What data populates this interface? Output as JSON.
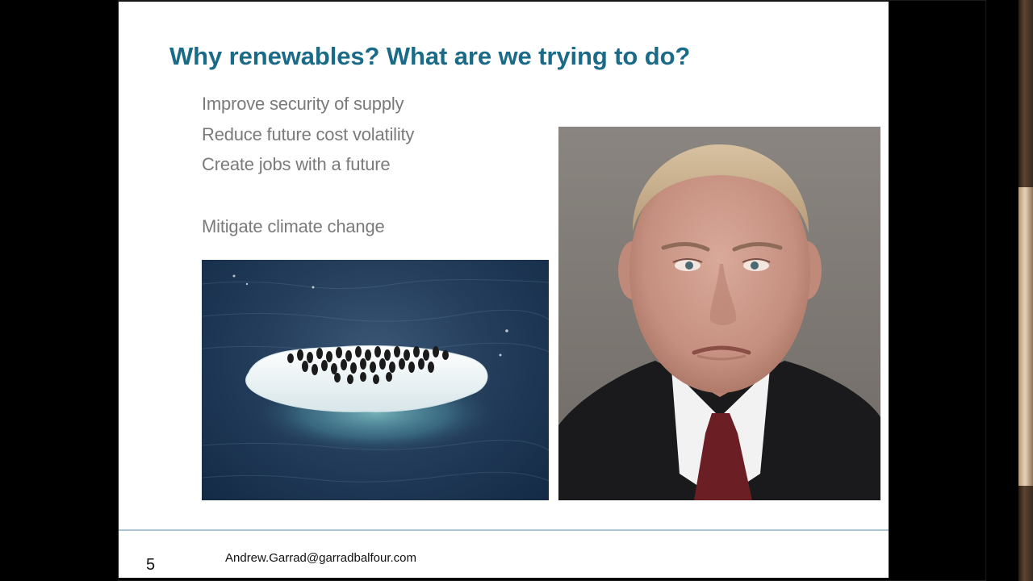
{
  "slide": {
    "title": "Why renewables? What are we trying to do?",
    "bullets": [
      "Improve security of supply",
      "Reduce future cost volatility",
      "Create jobs with a future",
      "Mitigate climate change"
    ],
    "page_number": "5",
    "footer_email": "Andrew.Garrad@garradbalfour.com"
  },
  "images": {
    "left": "penguins-on-iceberg-photo",
    "right": "portrait-photo"
  },
  "colors": {
    "title": "#1a6b88",
    "bullet_text": "#7a7a7a",
    "footer_rule": "#a9c4d0",
    "background": "#000000",
    "slide": "#ffffff"
  }
}
